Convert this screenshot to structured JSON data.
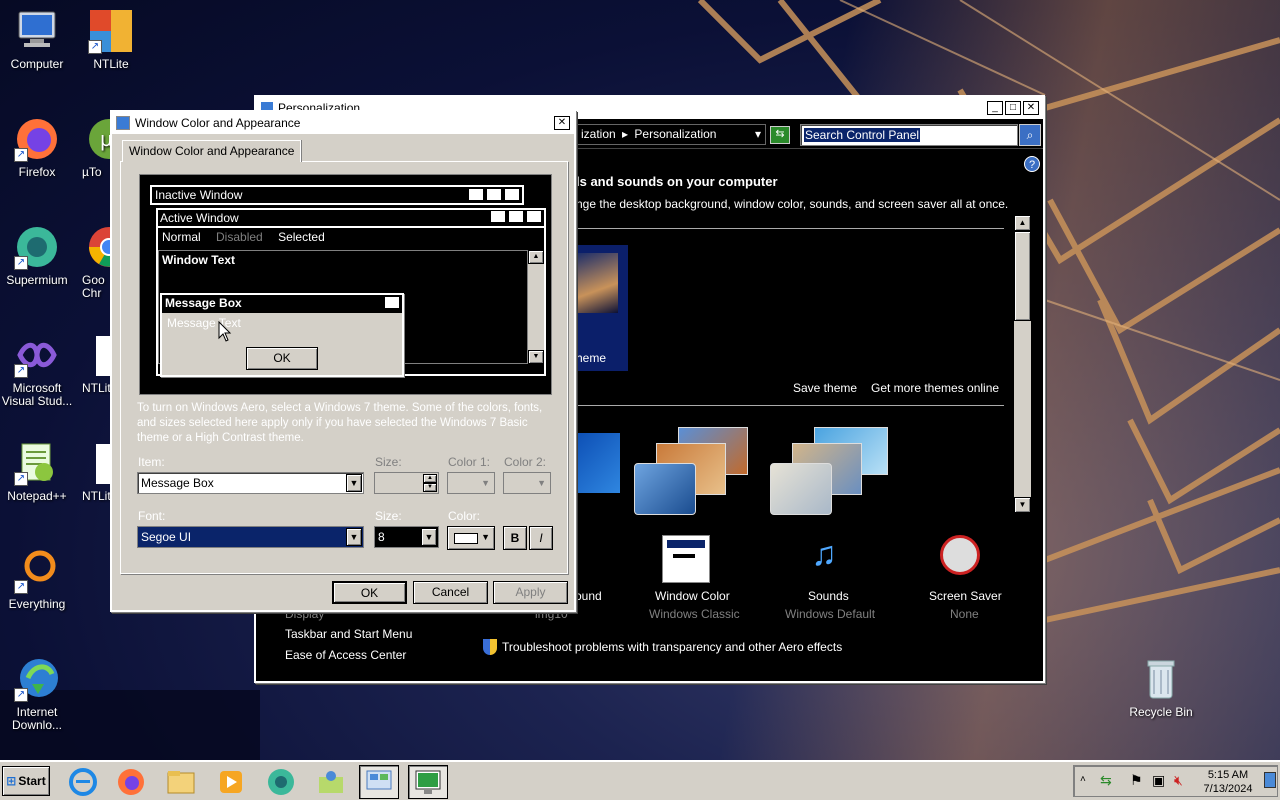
{
  "desktop": {
    "icons": [
      {
        "label": "Computer",
        "icon": "computer-icon"
      },
      {
        "label": "NTLite",
        "icon": "ntlite-icon"
      },
      {
        "label": "Firefox",
        "icon": "firefox-icon"
      },
      {
        "label": "µTo",
        "icon": "utorrent-icon"
      },
      {
        "label": "Supermium",
        "icon": "supermium-icon"
      },
      {
        "label": "Goo Chr",
        "icon": "chrome-icon"
      },
      {
        "label": "Microsoft Visual Stud...",
        "icon": "visual-studio-icon"
      },
      {
        "label": "NTLite",
        "icon": "ntlite-file-icon"
      },
      {
        "label": "Notepad++",
        "icon": "notepad-plus-icon"
      },
      {
        "label": "NTLite",
        "icon": "ntlite-file-icon"
      },
      {
        "label": "Everything",
        "icon": "everything-icon"
      },
      {
        "label": "Internet Downlo...",
        "icon": "idm-icon"
      },
      {
        "label": "Recycle Bin",
        "icon": "recycle-bin-icon"
      }
    ]
  },
  "personalization": {
    "title": "Personalization",
    "breadcrumb": [
      "ization",
      "Personalization"
    ],
    "search_value": "Search Control Panel",
    "heading": "ls and sounds on your computer",
    "subheading": "nge the desktop background, window color, sounds, and screen saver all at once.",
    "theme_label": "heme",
    "save_theme": "Save theme",
    "get_more": "Get more themes online",
    "see_also": [
      "Display",
      "Taskbar and Start Menu",
      "Ease of Access Center"
    ],
    "bottom_items": [
      {
        "label": "ound",
        "sub": "img10"
      },
      {
        "label": "Window Color",
        "sub": "Windows Classic"
      },
      {
        "label": "Sounds",
        "sub": "Windows Default"
      },
      {
        "label": "Screen Saver",
        "sub": "None"
      }
    ],
    "troubleshoot": "Troubleshoot problems with transparency and other Aero effects"
  },
  "appearance": {
    "title": "Window Color and Appearance",
    "tab": "Window Color and Appearance",
    "preview": {
      "inactive": "Inactive Window",
      "active": "Active Window",
      "menu": [
        "Normal",
        "Disabled",
        "Selected"
      ],
      "window_text": "Window Text",
      "msgbox_title": "Message Box",
      "msgbox_text": "Message Text",
      "ok": "OK"
    },
    "info": "To turn on Windows Aero, select a Windows 7 theme. Some of the colors, fonts, and sizes selected here apply only if you have selected the Windows 7 Basic theme or a High Contrast theme.",
    "item_label": "Item:",
    "item_value": "Message Box",
    "size_label": "Size:",
    "color1_label": "Color 1:",
    "color2_label": "Color 2:",
    "font_label": "Font:",
    "font_value": "Segoe UI",
    "font_size_label": "Size:",
    "font_size_value": "8",
    "font_color_label": "Color:",
    "bold": "B",
    "italic": "I",
    "ok": "OK",
    "cancel": "Cancel",
    "apply": "Apply"
  },
  "taskbar": {
    "start": "Start",
    "time": "5:15 AM",
    "date": "7/13/2024"
  }
}
